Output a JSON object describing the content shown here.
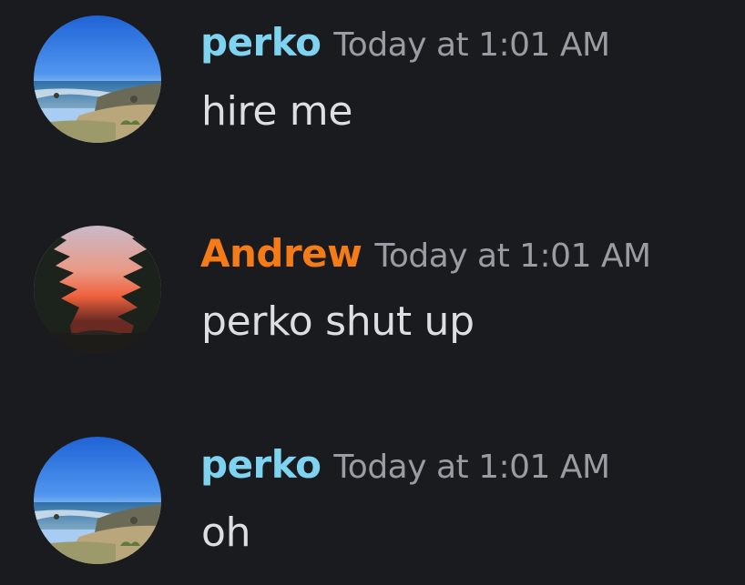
{
  "colors": {
    "background": "#1a1b1e",
    "perko_name": "#7dd3f0",
    "andrew_name": "#f47b16",
    "timestamp": "#9a9ca3",
    "message_text": "#dcdee1"
  },
  "messages": [
    {
      "author": "perko",
      "timestamp": "Today at 1:01 AM",
      "text": "hire me",
      "avatar": "beach-landscape"
    },
    {
      "author": "Andrew",
      "timestamp": "Today at 1:01 AM",
      "text": "perko shut up",
      "avatar": "sunset-trees"
    },
    {
      "author": "perko",
      "timestamp": "Today at 1:01 AM",
      "text": "oh",
      "avatar": "beach-landscape"
    }
  ]
}
